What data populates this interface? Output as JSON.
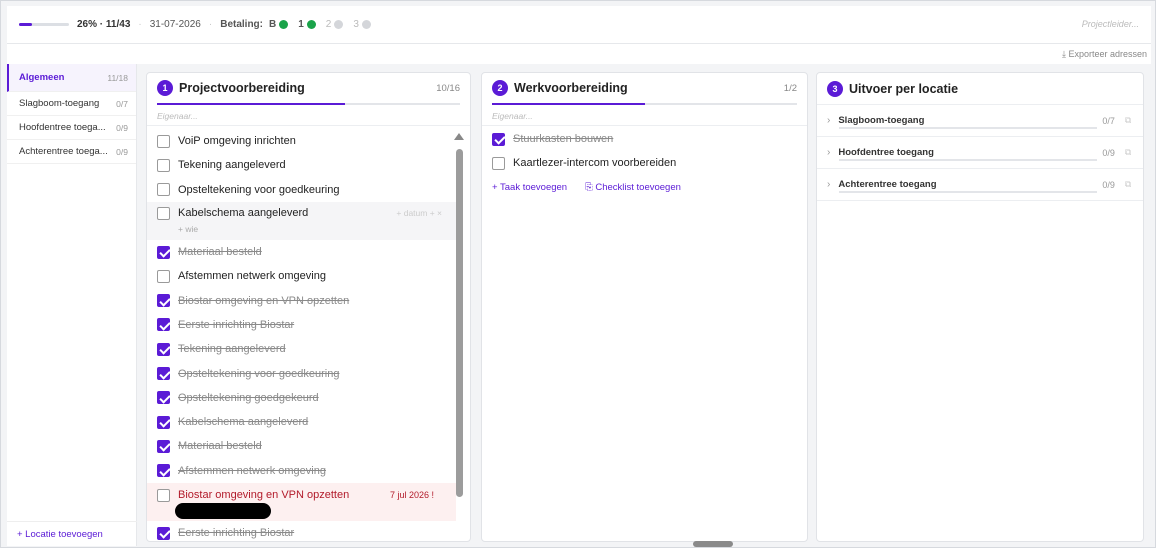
{
  "topbar": {
    "progress_percent": 26,
    "progress_label": "26% · 11/43",
    "date": "31-07-2026",
    "payment_label": "Betaling:",
    "payments": [
      {
        "label": "B",
        "color": "#1aa34a",
        "active": true
      },
      {
        "label": "1",
        "color": "#1aa34a",
        "active": true
      },
      {
        "label": "2",
        "color": "#d4d6da",
        "active": false
      },
      {
        "label": "3",
        "color": "#d4d6da",
        "active": false
      }
    ],
    "projectleider_placeholder": "Projectleider..."
  },
  "subbar": {
    "export_label": "⤓ Exporteer adressen"
  },
  "sidebar": {
    "items": [
      {
        "label": "Algemeen",
        "count": "11/18",
        "active": true
      },
      {
        "label": "Slagboom-toegang",
        "count": "0/7",
        "active": false
      },
      {
        "label": "Hoofdentree toega...",
        "count": "0/9",
        "active": false
      },
      {
        "label": "Achterentree toega...",
        "count": "0/9",
        "active": false
      }
    ],
    "add_location": "+ Locatie toevoegen"
  },
  "columns": [
    {
      "number": "1",
      "title": "Projectvoorbereiding",
      "count": "10/16",
      "progress_fraction": 0.62,
      "owner_placeholder": "Eigenaar...",
      "tasks": [
        {
          "text": "VoiP omgeving inrichten",
          "done": false,
          "state": "normal"
        },
        {
          "text": "Tekening aangeleverd",
          "done": false,
          "state": "normal"
        },
        {
          "text": "Opsteltekening voor goedkeuring",
          "done": false,
          "state": "normal"
        },
        {
          "text": "Kabelschema aangeleverd",
          "done": false,
          "state": "hover",
          "extra": "+ datum  +  ×",
          "wie": "+ wie"
        },
        {
          "text": "Materiaal besteld",
          "done": true,
          "state": "normal"
        },
        {
          "text": "Afstemmen netwerk omgeving",
          "done": false,
          "state": "normal"
        },
        {
          "text": "Biostar omgeving en VPN opzetten",
          "done": true,
          "state": "normal"
        },
        {
          "text": "Eerste inrichting Biostar",
          "done": true,
          "state": "normal"
        },
        {
          "text": "Tekening aangeleverd",
          "done": true,
          "state": "normal"
        },
        {
          "text": "Opsteltekening voor goedkeuring",
          "done": true,
          "state": "normal"
        },
        {
          "text": "Opsteltekening goedgekeurd",
          "done": true,
          "state": "normal"
        },
        {
          "text": "Kabelschema aangeleverd",
          "done": true,
          "state": "normal"
        },
        {
          "text": "Materiaal besteld",
          "done": true,
          "state": "normal"
        },
        {
          "text": "Afstemmen netwerk omgeving",
          "done": true,
          "state": "normal"
        },
        {
          "text": "Biostar omgeving en VPN opzetten",
          "done": false,
          "state": "overdue",
          "due": "7 jul 2026 !"
        },
        {
          "text": "Eerste inrichting Biostar",
          "done": true,
          "state": "normal"
        }
      ]
    },
    {
      "number": "2",
      "title": "Werkvoorbereiding",
      "count": "1/2",
      "progress_fraction": 0.5,
      "owner_placeholder": "Eigenaar...",
      "tasks": [
        {
          "text": "Stuurkasten bouwen",
          "done": true,
          "state": "normal"
        },
        {
          "text": "Kaartlezer-intercom voorbereiden",
          "done": false,
          "state": "normal"
        }
      ],
      "add_task": "+  Taak toevoegen",
      "add_checklist": "⎘  Checklist toevoegen"
    },
    {
      "number": "3",
      "title": "Uitvoer per locatie",
      "locations": [
        {
          "name": "Slagboom-toegang",
          "count": "0/7"
        },
        {
          "name": "Hoofdentree toegang",
          "count": "0/9"
        },
        {
          "name": "Achterentree toegang",
          "count": "0/9"
        }
      ]
    }
  ]
}
